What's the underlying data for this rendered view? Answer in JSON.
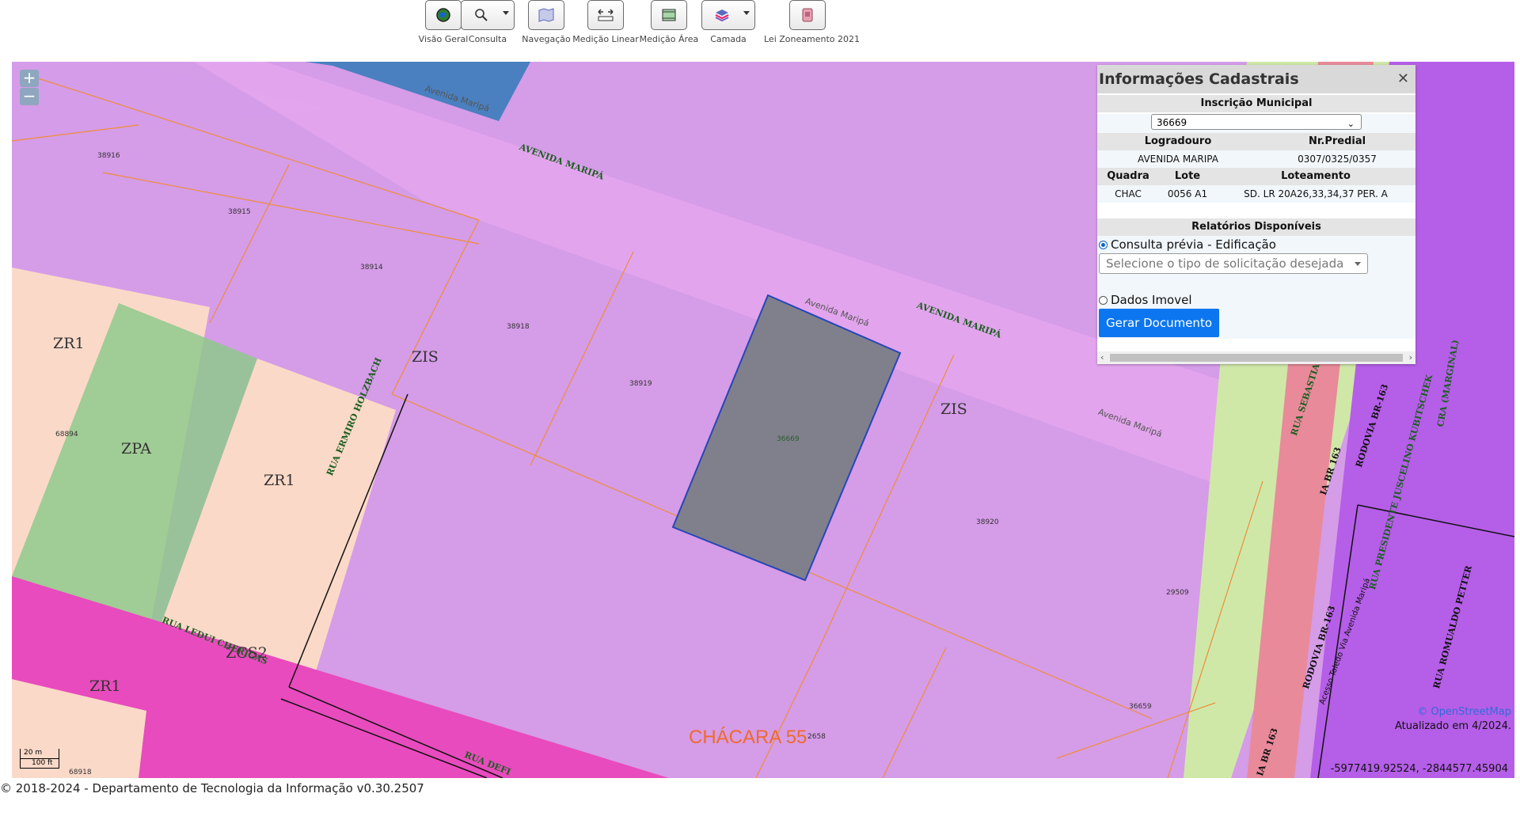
{
  "toolbar": {
    "tools": [
      {
        "label": "Visão Geral",
        "icon": "globe-icon"
      },
      {
        "label": "Consulta",
        "icon": "magnifier-icon"
      },
      {
        "label": "Navegação",
        "icon": "map-icon"
      },
      {
        "label": "Medição Linear",
        "icon": "ruler-icon"
      },
      {
        "label": "Medição Área",
        "icon": "area-icon"
      },
      {
        "label": "Camada",
        "icon": "layers-icon"
      },
      {
        "label": "Lei Zoneamento 2021",
        "icon": "book-icon"
      }
    ]
  },
  "map": {
    "zoom_in": "+",
    "zoom_out": "−",
    "zones": [
      "ZR1",
      "ZPA",
      "ZR1",
      "ZIS",
      "ZIS",
      "ZCS2",
      "ZR1"
    ],
    "lots": [
      "38916",
      "38915",
      "38914",
      "38918",
      "38919",
      "36669",
      "38920",
      "68894",
      "29509",
      "36659",
      "68918",
      "2658"
    ],
    "streets": {
      "avenida_maripa_1": "Avenida Maripá",
      "avenida_maripa_2": "AVENIDA MARIPÁ",
      "avenida_maripa_3": "Avenida Maripá",
      "avenida_maripa_4": "AVENIDA MARIPÁ",
      "avenida_maripa_5": "Avenida Maripá",
      "rua_ermiro": "RUA ERMIRO HOLZBACH",
      "rua_leduc": "RUA LEDUI CHERIGAS",
      "rua_defi": "RUA DEFI",
      "rua_sebastia": "RUA SEBASTIA",
      "br163_1": "IA BR 163",
      "br163_2": "RODOVIA BR-163",
      "br163_3": "RODOVIA BR-163",
      "br163_4": "IA BR 163",
      "rua_presidente": "RUA PRESIDENTE JUSCELINO KUBITSCHEK",
      "rua_romualdo": "RUA ROMUALDO PETTER",
      "marginal": "CRA (MARGINAL)",
      "acesso": "Acesso Toledo Via Avenida Maripá"
    },
    "place_label": "CHÁCARA 55",
    "scale": {
      "top": "20 m",
      "bottom": "100 ft"
    },
    "attribution": "© OpenStreetMap",
    "updated": "Atualizado em 4/2024.",
    "coordinates": "-5977419.92524, -2844577.45904"
  },
  "panel": {
    "title": "Informações Cadastrais",
    "close": "✕",
    "inscricao_header": "Inscrição Municipal",
    "inscricao_value": "36669",
    "logradouro_header": "Logradouro",
    "nrpredial_header": "Nr.Predial",
    "logradouro_value": "AVENIDA MARIPA",
    "nrpredial_value": "0307/0325/0357",
    "quadra_header": "Quadra",
    "lote_header": "Lote",
    "loteamento_header": "Loteamento",
    "quadra_value": "CHAC",
    "lote_value": "0056 A1",
    "loteamento_value": "SD. LR 20A26,33,34,37 PER. A",
    "relatorios_header": "Relatórios Disponíveis",
    "option1": "Consulta prévia - Edificação",
    "select_placeholder": "Selecione o tipo de solicitação desejada",
    "option2": "Dados Imovel",
    "button": "Gerar Documento"
  },
  "footer": "© 2018-2024 - Departamento de Tecnologia da Informação v0.30.2507",
  "colors": {
    "zis": "#d59ce8",
    "zr1": "#fbd9c8",
    "zpa": "#8fc98c",
    "zcs2": "#e84bbd",
    "selected_lot": "#80808c",
    "road_green": "#cfe8a8",
    "road_red": "#e88a9a",
    "purple_dark": "#b55ee8",
    "button_blue": "#0b76ef"
  }
}
